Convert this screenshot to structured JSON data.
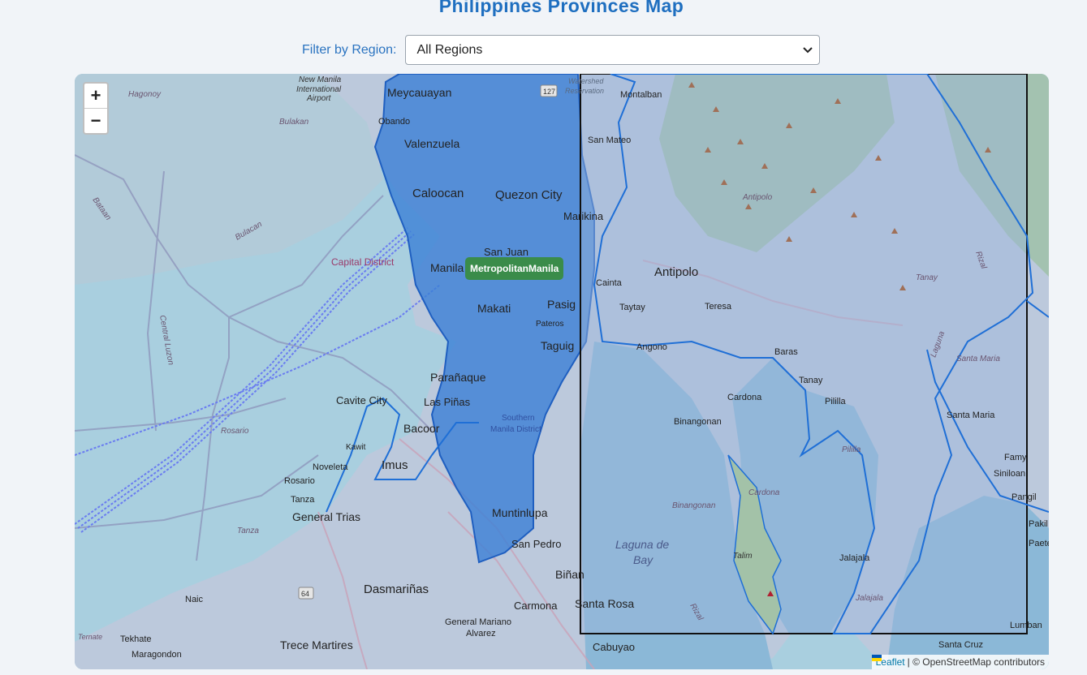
{
  "page": {
    "title": "Philippines Provinces Map"
  },
  "filter": {
    "label": "Filter by Region:",
    "selected": "All Regions"
  },
  "map": {
    "zoom": {
      "in": "+",
      "out": "−"
    },
    "highlight_label": "MetropolitanManila",
    "attribution": {
      "leaflet": "Leaflet",
      "rest": "| © OpenStreetMap contributors"
    },
    "places": [
      "Hagonoy",
      "New Manila International Airport",
      "Meycauayan",
      "Obando",
      "Bulakan",
      "Valenzuela",
      "Bataan",
      "Bulacan",
      "Caloocan",
      "Quezon City",
      "San Juan",
      "Capital District",
      "Manila",
      "Makati",
      "Pasig",
      "Pateros",
      "Taguig",
      "Parañaque",
      "Cavite City",
      "Las Piñas",
      "Bacoor",
      "Kawit",
      "Noveleta",
      "Imus",
      "Rosario",
      "Tanza",
      "General Trias",
      "Central Luzon",
      "Rosario",
      "Tanza",
      "Naic",
      "Dasmariñas",
      "Ternate",
      "Tekhate",
      "Maragondon",
      "Trece Martires",
      "General Mariano Alvarez",
      "Carmona",
      "Biñan",
      "Santa Rosa",
      "San Pedro",
      "Muntinlupa",
      "Southern Manila District",
      "Montalban",
      "San Mateo",
      "Marikina",
      "Antipolo",
      "Antipolo",
      "Cainta",
      "Taytay",
      "Teresa",
      "Angono",
      "Baras",
      "Tanay",
      "Tanay",
      "Cardona",
      "Pililla",
      "Binangonan",
      "Binangonan",
      "Cardona",
      "Laguna de Bay",
      "Pililla",
      "Talim",
      "Jalajala",
      "Jalajala",
      "Rizal",
      "Rizal",
      "Laguna",
      "Santa Maria",
      "Santa Maria",
      "Famy",
      "Siniloan",
      "Pangil",
      "Pakil",
      "Paete",
      "Lumban",
      "Santa Cruz",
      "Cabuyao",
      "Watershed Reservation"
    ]
  }
}
